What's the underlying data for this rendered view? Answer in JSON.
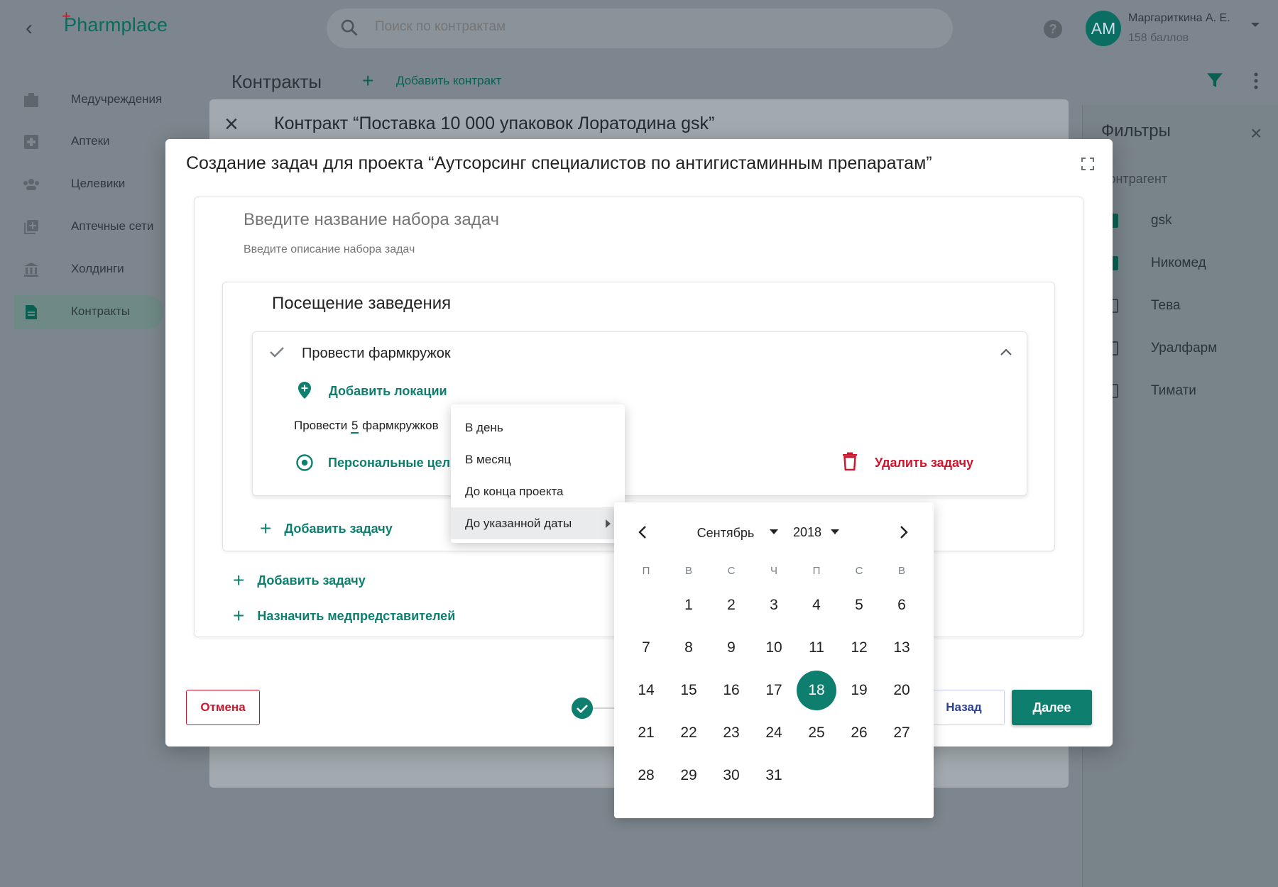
{
  "app": {
    "logo": "Pharmplace"
  },
  "search": {
    "placeholder": "Поиск по контрактам"
  },
  "user": {
    "initials": "АМ",
    "name": "Маргариткина А. Е.",
    "points": "158 баллов"
  },
  "sidebar": {
    "items": [
      {
        "label": "Медучреждения",
        "icon": "hospital-icon"
      },
      {
        "label": "Аптеки",
        "icon": "pharmacy-cross-icon"
      },
      {
        "label": "Целевики",
        "icon": "people-icon"
      },
      {
        "label": "Аптечные сети",
        "icon": "library-add-icon"
      },
      {
        "label": "Холдинги",
        "icon": "bank-icon"
      },
      {
        "label": "Контракты",
        "icon": "document-icon",
        "active": true
      }
    ]
  },
  "page": {
    "title": "Контракты",
    "add_contract": "Добавить контракт"
  },
  "filters": {
    "title": "Фильтры",
    "section": "Контрагент",
    "items": [
      {
        "label": "gsk",
        "checked": true
      },
      {
        "label": "Никомед",
        "checked": true
      },
      {
        "label": "Тева",
        "checked": false
      },
      {
        "label": "Уралфарм",
        "checked": false
      },
      {
        "label": "Тимати",
        "checked": false
      }
    ]
  },
  "contract_modal": {
    "title": "Контракт “Поставка 10 000 упаковок Лоратодина gsk”"
  },
  "dialog": {
    "title": "Создание задач для проекта “Аутсорсинг специалистов по антигистаминным препаратам”",
    "set_name_placeholder": "Введите название набора задач",
    "set_desc_placeholder": "Введите описание набора задач",
    "group_title": "Посещение заведения",
    "task": {
      "name": "Провести фармкружок",
      "add_locations": "Добавить локации",
      "desc_prefix": "Провести",
      "count": "5",
      "desc_suffix": "фармкружков",
      "personal_goals": "Персональные цели",
      "delete": "Удалить задачу"
    },
    "add_task_inner": "Добавить задачу",
    "add_task_outer": "Добавить задачу",
    "assign_reps": "Назначить медпредставителей",
    "cancel": "Отмена",
    "back": "Назад",
    "next": "Далее"
  },
  "period_menu": {
    "items": [
      "В день",
      "В месяц",
      "До конца проекта",
      "До указанной даты"
    ],
    "selected_index": 3
  },
  "calendar": {
    "month": "Сентябрь",
    "year": "2018",
    "weekdays": [
      "П",
      "В",
      "С",
      "Ч",
      "П",
      "С",
      "В"
    ],
    "first_weekday_index": 1,
    "days_in_month": 31,
    "selected_day": 18
  },
  "colors": {
    "accent": "#0e7f6f",
    "danger": "#d0142c",
    "link_blue": "#2a3f9a"
  }
}
